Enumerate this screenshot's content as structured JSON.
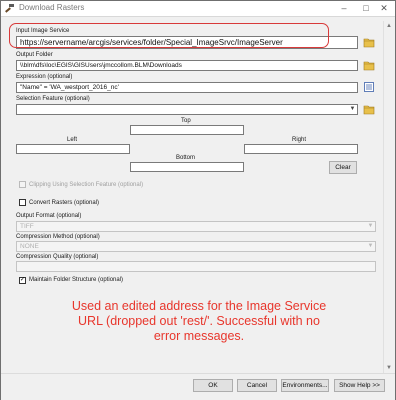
{
  "window": {
    "title": "Download Rasters"
  },
  "fields": {
    "input_service": {
      "label": "Input Image Service",
      "value": "https://servername/arcgis/services/folder/Special_ImageSrvc/ImageServer"
    },
    "output_folder": {
      "label": "Output Folder",
      "value": "\\\\blm\\dfs\\loc\\EGIS\\GISUsers\\jmccollom.BLM\\Downloads"
    },
    "expression": {
      "label": "Expression (optional)",
      "value": "\"Name\" = 'WA_westport_2016_nc'"
    },
    "selection_feature": {
      "label": "Selection Feature (optional)",
      "value": ""
    },
    "extent": {
      "top": "Top",
      "left": "Left",
      "right": "Right",
      "bottom": "Bottom",
      "clear": "Clear"
    },
    "clipping": {
      "label": "Clipping Using Selection Feature (optional)"
    },
    "convert": {
      "label": "Convert Rasters (optional)"
    },
    "output_format": {
      "label": "Output Format (optional)",
      "value": "TIFF"
    },
    "compression_method": {
      "label": "Compression Method (optional)",
      "value": "NONE"
    },
    "compression_quality": {
      "label": "Compression Quality (optional)",
      "value": ""
    },
    "maintain_folder": {
      "label": "Maintain Folder Structure (optional)",
      "checked": true
    }
  },
  "annotation": {
    "lines": [
      "Used an edited address for the Image Service",
      "URL (dropped out 'rest/'. Successful with no",
      "error messages."
    ]
  },
  "buttons": {
    "ok": "OK",
    "cancel": "Cancel",
    "environments": "Environments...",
    "show_help": "Show Help >>"
  },
  "colors": {
    "annotation": "#e8362c",
    "highlight": "#d83a3a"
  }
}
